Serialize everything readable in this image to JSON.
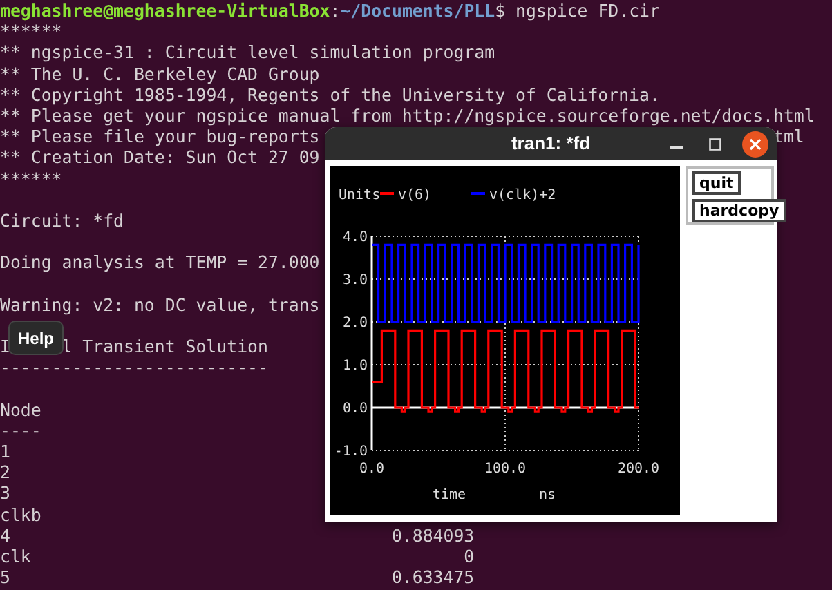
{
  "terminal": {
    "lines": [
      {
        "kind": "prompt",
        "user": "meghashree@meghashree-VirtualBox",
        "separator": ":",
        "path": "~/Documents/PLL",
        "symbol": "$",
        "command": "ngspice FD.cir"
      },
      {
        "kind": "text",
        "text": "******"
      },
      {
        "kind": "text",
        "text": "** ngspice-31 : Circuit level simulation program"
      },
      {
        "kind": "text",
        "text": "** The U. C. Berkeley CAD Group"
      },
      {
        "kind": "text",
        "text": "** Copyright 1985-1994, Regents of the University of California."
      },
      {
        "kind": "text",
        "text": "** Please get your ngspice manual from http://ngspice.sourceforge.net/docs.html"
      },
      {
        "kind": "split",
        "parts": [
          "** Please file your bug-reports",
          "tml"
        ]
      },
      {
        "kind": "text",
        "text": "** Creation Date: Sun Oct 27 09"
      },
      {
        "kind": "text",
        "text": "******"
      },
      {
        "kind": "blank"
      },
      {
        "kind": "text",
        "text": "Circuit: *fd"
      },
      {
        "kind": "blank"
      },
      {
        "kind": "text",
        "text": "Doing analysis at TEMP = 27.000"
      },
      {
        "kind": "blank"
      },
      {
        "kind": "text",
        "text": "Warning: v2: no DC value, trans"
      },
      {
        "kind": "blank"
      },
      {
        "kind": "split",
        "parts": [
          "I",
          "l Transient Solution"
        ]
      },
      {
        "kind": "text",
        "text": "--------------------------"
      },
      {
        "kind": "blank"
      },
      {
        "kind": "text",
        "text": "Node"
      },
      {
        "kind": "text",
        "text": "----"
      },
      {
        "kind": "text",
        "text": "1"
      },
      {
        "kind": "text",
        "text": "2"
      },
      {
        "kind": "text",
        "text": "3"
      },
      {
        "kind": "text",
        "text": "clkb"
      },
      {
        "kind": "row",
        "text": "4",
        "value": "0.884093"
      },
      {
        "kind": "row",
        "text": "clk",
        "value": "0"
      },
      {
        "kind": "row",
        "text": "5",
        "value": "0.633475"
      }
    ]
  },
  "tooltip": {
    "text": "Help"
  },
  "plot_window": {
    "title": "tran1: *fd",
    "buttons": [
      "quit",
      "hardcopy"
    ],
    "x_units": "ns",
    "chart_data": {
      "type": "line",
      "ylabel": "Units",
      "xlabel": "time",
      "grid": true,
      "legend": true,
      "x": [
        0,
        2.5,
        5,
        7.5,
        10,
        12.5,
        15,
        17.5,
        20,
        22.5,
        25,
        27.5,
        30,
        32.5,
        35,
        37.5,
        40,
        42.5,
        45,
        47.5,
        50,
        52.5,
        55,
        57.5,
        60,
        62.5,
        65,
        67.5,
        70,
        72.5,
        75,
        77.5,
        80,
        82.5,
        85,
        87.5,
        90,
        92.5,
        95,
        97.5,
        100,
        102.5,
        105,
        107.5,
        110,
        112.5,
        115,
        117.5,
        120,
        122.5,
        125,
        127.5,
        130,
        132.5,
        135,
        137.5,
        140,
        142.5,
        145,
        147.5,
        150,
        152.5,
        155,
        157.5,
        160,
        162.5,
        165,
        167.5,
        170,
        172.5,
        175,
        177.5,
        180,
        182.5,
        185,
        187.5,
        190,
        192.5,
        195,
        197.5,
        200
      ],
      "series": [
        {
          "name": "v(6)",
          "color": "#ff0000",
          "values": [
            0.6,
            0.6,
            0.6,
            1.8,
            1.8,
            1.8,
            1.8,
            0,
            0,
            -0.1,
            0,
            1.8,
            1.8,
            1.8,
            1.8,
            0,
            0,
            -0.1,
            0,
            1.8,
            1.8,
            1.8,
            1.8,
            0,
            0,
            -0.1,
            0,
            1.8,
            1.8,
            1.8,
            1.8,
            0,
            0,
            -0.1,
            0,
            1.8,
            1.8,
            1.8,
            1.8,
            0,
            0,
            -0.1,
            0,
            1.8,
            1.8,
            1.8,
            1.8,
            0,
            0,
            -0.1,
            0,
            1.8,
            1.8,
            1.8,
            1.8,
            0,
            0,
            -0.1,
            0,
            1.8,
            1.8,
            1.8,
            1.8,
            0,
            0,
            -0.1,
            0,
            1.8,
            1.8,
            1.8,
            1.8,
            0,
            0,
            -0.1,
            0,
            1.8,
            1.8,
            1.8,
            1.8,
            0,
            0
          ]
        },
        {
          "name": "v(clk)+2",
          "color": "#0000ff",
          "values": [
            3.8,
            3.8,
            2,
            2,
            3.8,
            3.8,
            2,
            2,
            3.8,
            3.8,
            2,
            2,
            3.8,
            3.8,
            2,
            2,
            3.8,
            3.8,
            2,
            2,
            3.8,
            3.8,
            2,
            2,
            3.8,
            3.8,
            2,
            2,
            3.8,
            3.8,
            2,
            2,
            3.8,
            3.8,
            2,
            2,
            3.8,
            3.8,
            2,
            2,
            3.8,
            3.8,
            2,
            2,
            3.8,
            3.8,
            2,
            2,
            3.8,
            3.8,
            2,
            2,
            3.8,
            3.8,
            2,
            2,
            3.8,
            3.8,
            2,
            2,
            3.8,
            3.8,
            2,
            2,
            3.8,
            3.8,
            2,
            2,
            3.8,
            3.8,
            2,
            2,
            3.8,
            3.8,
            2,
            2,
            3.8,
            3.8,
            2,
            2,
            3.8
          ]
        }
      ],
      "xlim": [
        0,
        200
      ],
      "ylim": [
        -1,
        4
      ],
      "xticks": [
        {
          "value": 0,
          "label": "0.0"
        },
        {
          "value": 100,
          "label": "100.0"
        },
        {
          "value": 200,
          "label": "200.0"
        }
      ],
      "yticks": [
        {
          "value": 4,
          "label": "4.0"
        },
        {
          "value": 3,
          "label": "3.0"
        },
        {
          "value": 2,
          "label": "2.0"
        },
        {
          "value": 1,
          "label": "1.0"
        },
        {
          "value": 0,
          "label": "0.0"
        },
        {
          "value": -1,
          "label": "-1.0"
        }
      ]
    }
  }
}
